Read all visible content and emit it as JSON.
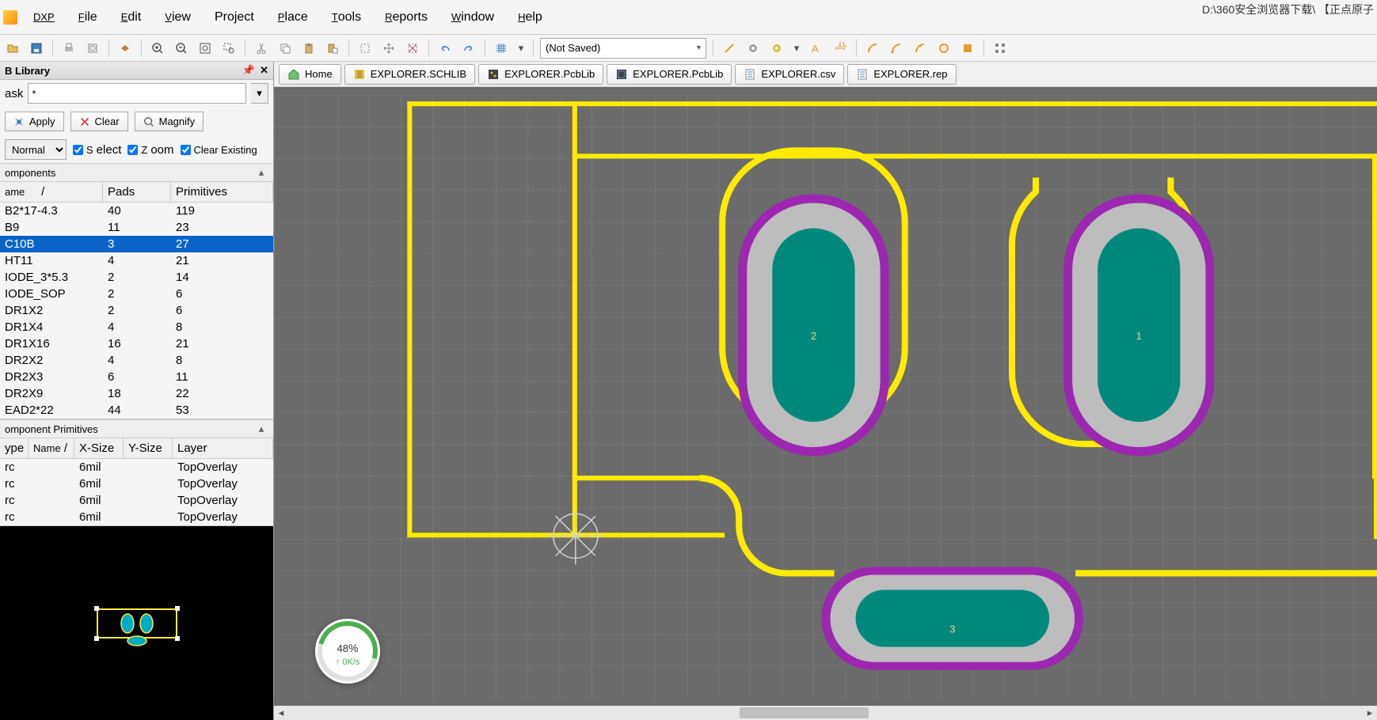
{
  "title_path": "D:\\360安全浏览器下载\\ 【正点原子",
  "menu": {
    "dxp": "DXP",
    "file": "File",
    "edit": "Edit",
    "view": "View",
    "project": "Project",
    "place": "Place",
    "tools": "Tools",
    "reports": "Reports",
    "window": "Window",
    "help": "Help"
  },
  "toolbar": {
    "combo_value": "(Not Saved)"
  },
  "tabs": {
    "home": "Home",
    "schlib": "EXPLORER.SCHLIB",
    "pcblib1": "EXPLORER.PcbLib",
    "pcblib2": "EXPLORER.PcbLib",
    "csv": "EXPLORER.csv",
    "rep": "EXPLORER.rep"
  },
  "panel": {
    "title": "B Library",
    "mask_label": "ask",
    "mask_value": "*",
    "apply": "Apply",
    "clear": "Clear",
    "magnify": "Magnify",
    "mode": "Normal",
    "select": "Select",
    "zoom": "Zoom",
    "clear_existing": "Clear Existing"
  },
  "components": {
    "header": "omponents",
    "cols": {
      "name": "ame",
      "pads": "Pads",
      "prim": "Primitives"
    },
    "rows": [
      {
        "name": "B2*17-4.3",
        "pads": "40",
        "prim": "119",
        "sel": false
      },
      {
        "name": "B9",
        "pads": "11",
        "prim": "23",
        "sel": false
      },
      {
        "name": "C10B",
        "pads": "3",
        "prim": "27",
        "sel": true
      },
      {
        "name": "HT11",
        "pads": "4",
        "prim": "21",
        "sel": false
      },
      {
        "name": "IODE_3*5.3",
        "pads": "2",
        "prim": "14",
        "sel": false
      },
      {
        "name": "IODE_SOP",
        "pads": "2",
        "prim": "6",
        "sel": false
      },
      {
        "name": "DR1X2",
        "pads": "2",
        "prim": "6",
        "sel": false
      },
      {
        "name": "DR1X4",
        "pads": "4",
        "prim": "8",
        "sel": false
      },
      {
        "name": "DR1X16",
        "pads": "16",
        "prim": "21",
        "sel": false
      },
      {
        "name": "DR2X2",
        "pads": "4",
        "prim": "8",
        "sel": false
      },
      {
        "name": "DR2X3",
        "pads": "6",
        "prim": "11",
        "sel": false
      },
      {
        "name": "DR2X9",
        "pads": "18",
        "prim": "22",
        "sel": false
      },
      {
        "name": "EAD2*22",
        "pads": "44",
        "prim": "53",
        "sel": false
      }
    ]
  },
  "primitives": {
    "header": "omponent Primitives",
    "cols": {
      "type": "ype",
      "name": "Name",
      "xs": "X-Size",
      "ys": "Y-Size",
      "layer": "Layer"
    },
    "rows": [
      {
        "type": "rc",
        "name": "",
        "xs": "6mil",
        "ys": "",
        "layer": "TopOverlay"
      },
      {
        "type": "rc",
        "name": "",
        "xs": "6mil",
        "ys": "",
        "layer": "TopOverlay"
      },
      {
        "type": "rc",
        "name": "",
        "xs": "6mil",
        "ys": "",
        "layer": "TopOverlay"
      },
      {
        "type": "rc",
        "name": "",
        "xs": "6mil",
        "ys": "",
        "layer": "TopOverlay"
      }
    ]
  },
  "pads": {
    "p1": "1",
    "p2": "2",
    "p3": "3"
  },
  "speed": {
    "value": "48",
    "pct": "%",
    "sub": "↑ 0K/s"
  }
}
